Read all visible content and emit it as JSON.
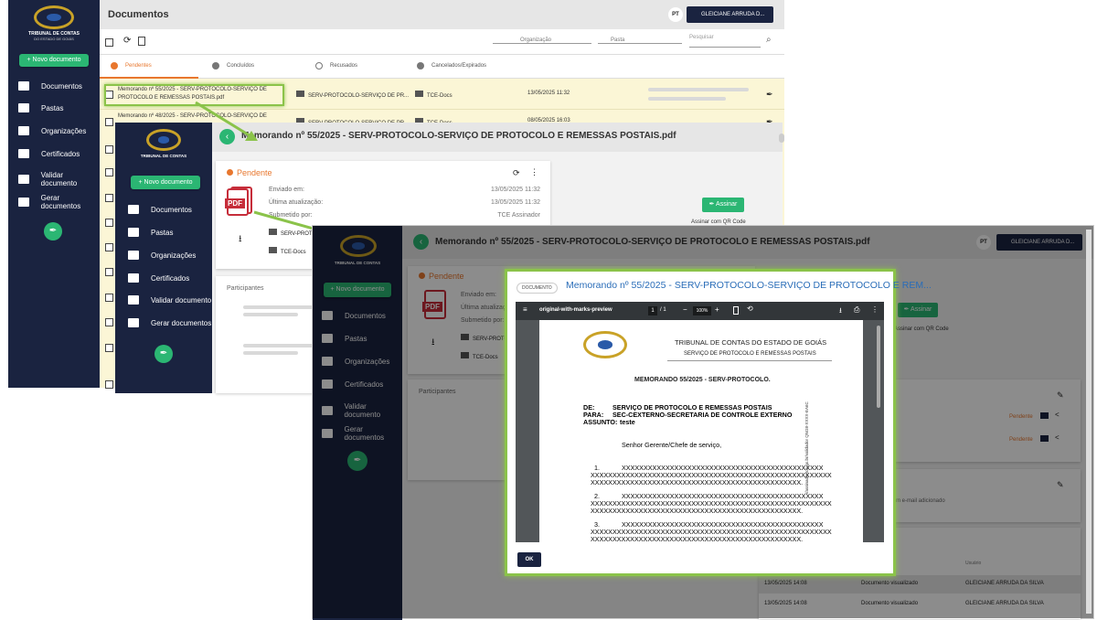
{
  "app": {
    "logo_line1": "TRIBUNAL DE CONTAS",
    "logo_line2": "DO ESTADO DE GOIÁS",
    "new_doc": "+ Novo documento",
    "user": "GLEICIANE ARRUDA D...",
    "lang": "PT"
  },
  "nav": [
    {
      "label": "Documentos"
    },
    {
      "label": "Pastas"
    },
    {
      "label": "Organizações"
    },
    {
      "label": "Certificados"
    },
    {
      "label": "Validar documento"
    },
    {
      "label": "Gerar documentos"
    }
  ],
  "header": {
    "title": "Documentos",
    "org_placeholder": "Organização",
    "folder_placeholder": "Pasta",
    "search_placeholder": "Pesquisar"
  },
  "tabs": [
    {
      "label": "Pendentes",
      "color": "#e8772e"
    },
    {
      "label": "Concluídos"
    },
    {
      "label": "Recusados"
    },
    {
      "label": "Cancelados/Expirados"
    }
  ],
  "rows": [
    {
      "name1": "Memorando nº 55/2025 - SERV-PROTOCOLO-SERVIÇO DE",
      "name2": "PROTOCOLO E REMESSAS POSTAIS.pdf",
      "org": "SERV-PROTOCOLO-SERVIÇO DE PR...",
      "folder": "TCE-Docs",
      "date": "13/05/2025 11:32"
    },
    {
      "name1": "Memorando nº 48/2025 - SERV-PROTOCOLO-SERVIÇO DE",
      "name2": "",
      "org": "SERV-PROTOCOLO-SERVIÇO DE PR...",
      "folder": "TCE-Docs",
      "date": "08/05/2025 16:03"
    }
  ],
  "detail": {
    "title": "Memorando nº 55/2025 - SERV-PROTOCOLO-SERVIÇO DE PROTOCOLO E REMESSAS POSTAIS.pdf",
    "status": "Pendente",
    "sent_label": "Enviado em:",
    "sent": "13/05/2025 11:32",
    "updated_label": "Última atualização:",
    "updated": "13/05/2025 11:32",
    "submitted_label": "Submetido por:",
    "submitted": "TCE Assinador",
    "org": "SERV-PROTO",
    "folder": "TCE-Docs",
    "sign": "Assinar",
    "qr": "Assinar com QR Code",
    "participants": "Participantes",
    "pdf": "PDF"
  },
  "history": {
    "user_col": "Usuário",
    "rows": [
      {
        "date": "13/05/2025 14:08",
        "action": "Documento visualizado",
        "user": "GLEICIANE ARRUDA DA SILVA"
      },
      {
        "date": "13/05/2025 14:08",
        "action": "Documento visualizado",
        "user": "GLEICIANE ARRUDA DA SILVA"
      }
    ],
    "pending": "Pendente",
    "email_note": "m e-mail adicionado"
  },
  "modal": {
    "badge": "DOCUMENTO",
    "title": "Memorando nº 55/2025 - SERV-PROTOCOLO-SERVIÇO DE PROTOCOLO E REM...",
    "file": "original-with-marks-preview",
    "page": "1",
    "pages": "/ 1",
    "zoom": "100%",
    "ok": "OK"
  },
  "doc": {
    "org": "TRIBUNAL DE CONTAS DO ESTADO DE GOIÁS",
    "dept": "SERVIÇO DE PROTOCOLO E REMESSAS POSTAIS",
    "memo": "MEMORANDO  55/2025 - SERV-PROTOCOLO.",
    "de_l": "DE:",
    "de": "SERVIÇO DE PROTOCOLO E REMESSAS POSTAIS",
    "para_l": "PARA:",
    "para": "SEC-CEXTERNO-SECRETARIA DE CONTROLE EXTERNO",
    "assunto_l": "ASSUNTO:",
    "assunto": "teste",
    "greeting": "Senhor Gerente/Chefe de serviço,",
    "p1n": "1.",
    "p2n": "2.",
    "p3n": "3.",
    "xline_a": "XXXXXXXXXXXXXXXXXXXXXXXXXXXXXXXXXXXXXXXXXXXXXX",
    "xline_b": "XXXXXXXXXXXXXXXXXXXXXXXXXXXXXXXXXXXXXXXXXXXXXXXXXXXXXXX",
    "xline_c": "XXXXXXXXXXXXXXXXXXXXXXXXXXXXXXXXXXXXXXXXXXXXXXXX.",
    "side": "//assinador.tce.go.br/validador QNG8-XXXX-EA6C"
  }
}
